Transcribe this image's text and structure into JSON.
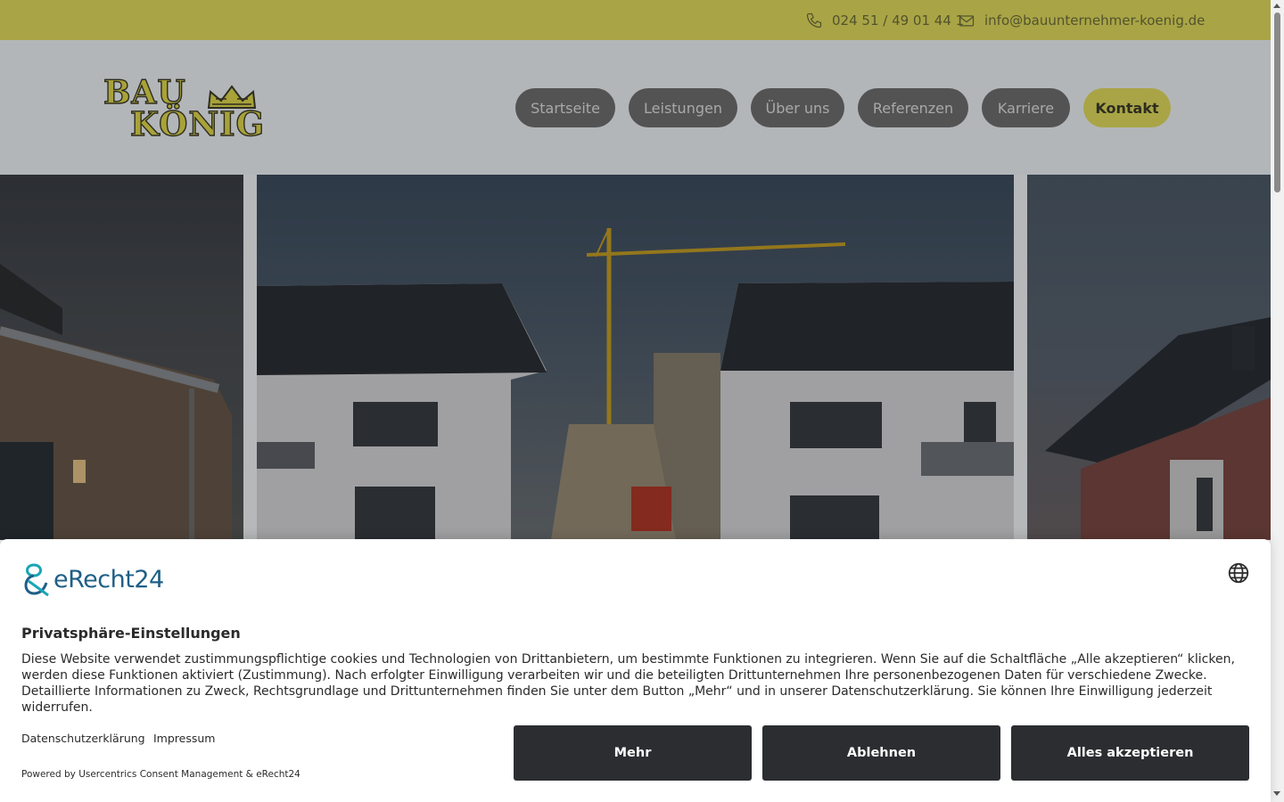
{
  "topbar": {
    "phone": "024 51 / 49 01 44 1",
    "email": "info@bauunternehmer-koenig.de",
    "phone_icon": "phone-icon",
    "email_icon": "mail-icon"
  },
  "logo": {
    "line1": "BAU",
    "line2": "KÖNIG",
    "icon": "crown-icon"
  },
  "nav": {
    "items": [
      {
        "label": "Startseite"
      },
      {
        "label": "Leistungen"
      },
      {
        "label": "Über uns"
      },
      {
        "label": "Referenzen"
      },
      {
        "label": "Karriere"
      },
      {
        "label": "Kontakt"
      }
    ],
    "active": "Kontakt"
  },
  "colors": {
    "brand_yellow": "#d9d45a",
    "nav_pill": "#6b6b6b",
    "consent_button": "#2b2d31",
    "erecht_blue": "#1f5f86"
  },
  "consent": {
    "brand": "eRecht24",
    "title": "Privatsphäre-Einstellungen",
    "text": "Diese Website verwendet zustimmungspflichtige cookies und Technologien von Drittanbietern, um bestimmte Funktionen zu integrieren. Wenn Sie auf die Schaltfläche „Alle akzeptieren“ klicken, werden diese Funktionen aktiviert (Zustimmung). Nach erfolgter Einwilligung verarbeiten wir und die beteiligten Drittunternehmen Ihre personenbezogenen Daten für verschiedene Zwecke. Detaillierte Informationen zu Zweck, Rechtsgrundlage und Drittunternehmen finden Sie unter dem Button „Mehr“ und in unserer Datenschutzerklärung. Sie können Ihre Einwilligung jederzeit widerrufen.",
    "link_privacy": "Datenschutzerklärung",
    "link_imprint": "Impressum",
    "powered_by": "Powered by Usercentrics Consent Management & eRecht24",
    "btn_more": "Mehr",
    "btn_decline": "Ablehnen",
    "btn_accept": "Alles akzeptieren",
    "language_icon": "globe-icon"
  }
}
